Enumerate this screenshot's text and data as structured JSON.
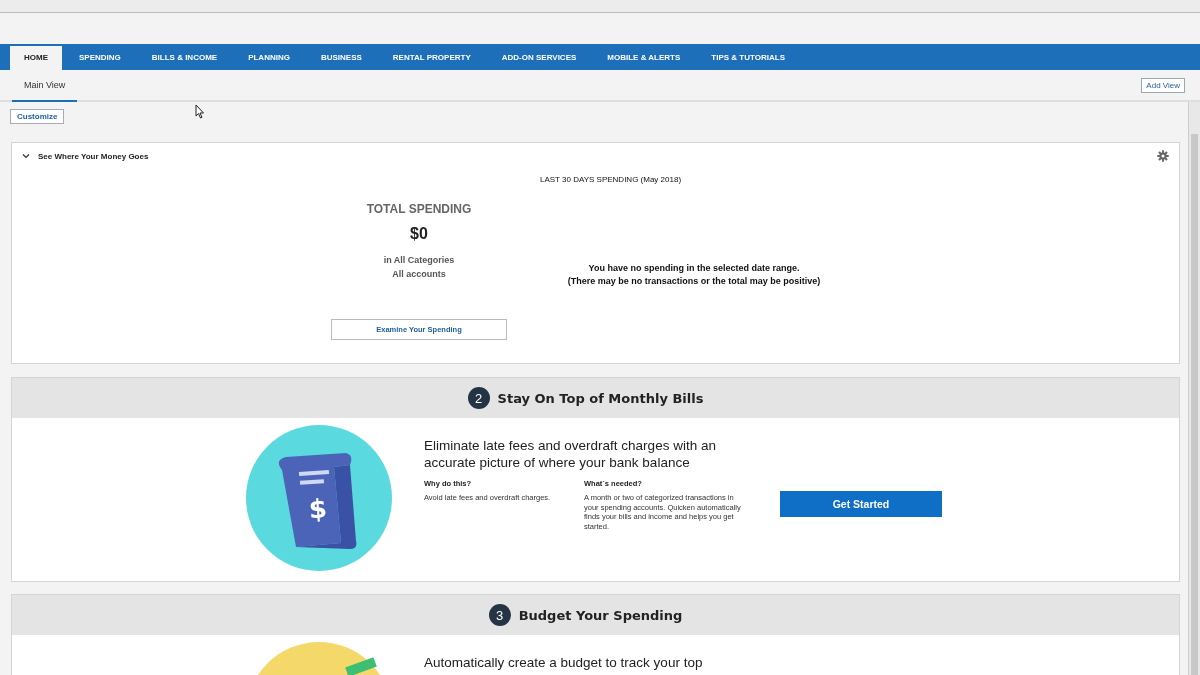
{
  "tabs": [
    {
      "label": "HOME",
      "selected": true
    },
    {
      "label": "SPENDING",
      "selected": false
    },
    {
      "label": "BILLS & INCOME",
      "selected": false
    },
    {
      "label": "PLANNING",
      "selected": false
    },
    {
      "label": "BUSINESS",
      "selected": false
    },
    {
      "label": "RENTAL PROPERTY",
      "selected": false
    },
    {
      "label": "ADD-ON SERVICES",
      "selected": false
    },
    {
      "label": "MOBILE & ALERTS",
      "selected": false
    },
    {
      "label": "TIPS & TUTORIALS",
      "selected": false
    }
  ],
  "subtabs": [
    {
      "label": "Main View",
      "selected": true
    }
  ],
  "add_view_button": "Add View",
  "customize_button": "Customize",
  "spending_panel": {
    "title": "See Where Your Money Goes",
    "expanded": true,
    "period_heading": "LAST 30 DAYS SPENDING (May 2018)",
    "total_label": "TOTAL SPENDING",
    "total_value": "$0",
    "scope_lines": [
      "in All Categories",
      "All accounts"
    ],
    "empty_message": [
      "You have no spending in the selected date range.",
      "(There may be no transactions or the total may be positive)"
    ],
    "action_button": "Examine Your Spending"
  },
  "steps": [
    {
      "kind": "bills",
      "symbol": "$",
      "number": "2",
      "title": "Stay On Top of Monthly Bills",
      "description": "Eliminate late fees and overdraft charges with an accurate picture of where your bank balance",
      "why_heading": "Why do this?",
      "why_text": "Avoid late fees and overdraft charges.",
      "needed_heading": "What´s needed?",
      "needed_text": "A month or two of categorized transactions in your spending accounts. Quicken automatically finds your bills and income and helps you get started.",
      "button": "Get Started"
    },
    {
      "kind": "budget",
      "number": "3",
      "title": "Budget Your Spending",
      "description": "Automatically create a budget to track your top"
    }
  ]
}
